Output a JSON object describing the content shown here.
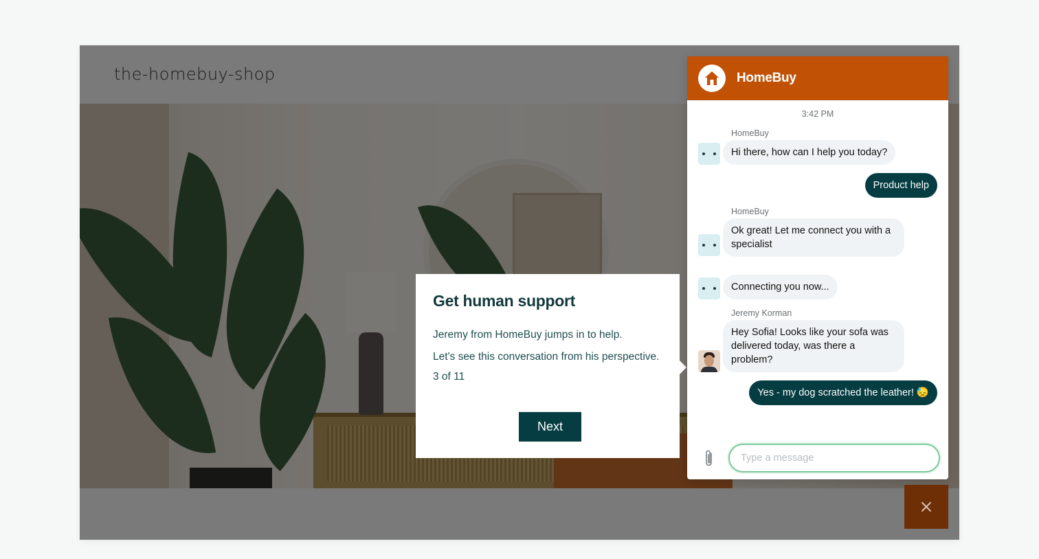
{
  "site": {
    "title": "the-homebuy-shop"
  },
  "tour": {
    "title": "Get human support",
    "paragraph_1": "Jeremy from HomeBuy jumps in to help.",
    "paragraph_2": "Let's see this conversation from his perspective.",
    "step": "3 of 11",
    "next_label": "Next"
  },
  "chat": {
    "brand_name": "HomeBuy",
    "brand_color": "#c05105",
    "timestamp": "3:42 PM",
    "messages": [
      {
        "sender": "HomeBuy",
        "direction": "in",
        "avatar": "bot-icon",
        "text": "Hi there, how can I help you today?"
      },
      {
        "direction": "out",
        "text": "Product help"
      },
      {
        "sender": "HomeBuy",
        "direction": "in",
        "avatar": "bot-icon",
        "text": "Ok great!  Let me connect you with a specialist"
      },
      {
        "direction": "in",
        "avatar": "bot-icon",
        "text": "Connecting you now..."
      },
      {
        "sender": "Jeremy Korman",
        "direction": "in",
        "avatar": "agent-photo",
        "text": "Hey Sofia! Looks like your sofa was delivered today, was there a problem?"
      },
      {
        "direction": "out",
        "text": "Yes - my dog scratched the leather! 😓"
      }
    ],
    "input_placeholder": "Type a message",
    "input_value": ""
  },
  "icons": {
    "logo": "house-icon",
    "attach": "paperclip-icon",
    "close": "close-icon"
  },
  "colors": {
    "dark_teal": "#053d42",
    "launcher": "#6e2f06",
    "input_focus": "#7cc99a"
  }
}
